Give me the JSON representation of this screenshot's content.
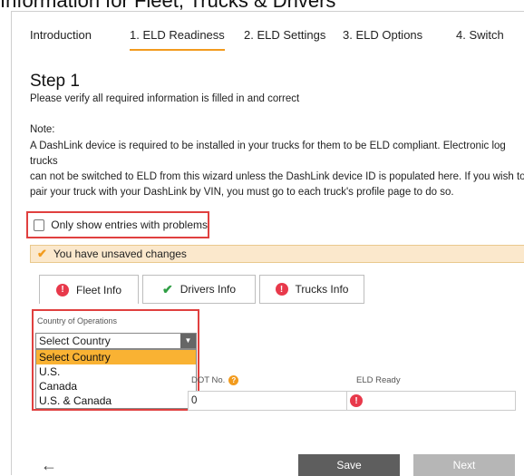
{
  "page_heading": "Information for Fleet, Trucks & Drivers",
  "wizard_tabs": [
    {
      "label": "Introduction",
      "active": false
    },
    {
      "label": "1. ELD Readiness",
      "active": true
    },
    {
      "label": "2. ELD Settings",
      "active": false
    },
    {
      "label": "3. ELD Options",
      "active": false
    },
    {
      "label": "4. Switch",
      "active": false
    }
  ],
  "step": {
    "title": "Step 1",
    "instruction": "Please verify all required information is filled in and correct",
    "note_label": "Note:",
    "note_lines": [
      "A DashLink device is required to be installed in your trucks for them to be ELD compliant. Electronic log trucks",
      "can not be switched to ELD from this wizard unless the DashLink device ID is populated here. If you wish to",
      "pair your truck with your DashLink by VIN, you must go to each truck's profile page to do so."
    ]
  },
  "filter": {
    "label": "Only show entries with problems",
    "checked": false
  },
  "warning": {
    "text": "You have unsaved changes",
    "icon": "check-icon"
  },
  "sub_tabs": [
    {
      "label": "Fleet Info",
      "icon": "error-icon",
      "active": true
    },
    {
      "label": "Drivers Info",
      "icon": "check-icon",
      "active": false
    },
    {
      "label": "Trucks Info",
      "icon": "error-icon",
      "active": false
    }
  ],
  "country": {
    "label": "Country of Operations",
    "selected": "Select Country",
    "options": [
      "Select Country",
      "U.S.",
      "Canada",
      "U.S. & Canada"
    ]
  },
  "table": {
    "columns": [
      "DOT No.",
      "ELD Ready"
    ],
    "row": {
      "dot_no": "0",
      "eld_ready_icon": "error-icon"
    }
  },
  "footer": {
    "back_icon": "arrow-left-icon",
    "save_label": "Save",
    "next_label": "Next"
  },
  "colors": {
    "accent": "#f29b1e",
    "error": "#e8394b",
    "highlight": "#e0403f",
    "success": "#2f9e44"
  }
}
